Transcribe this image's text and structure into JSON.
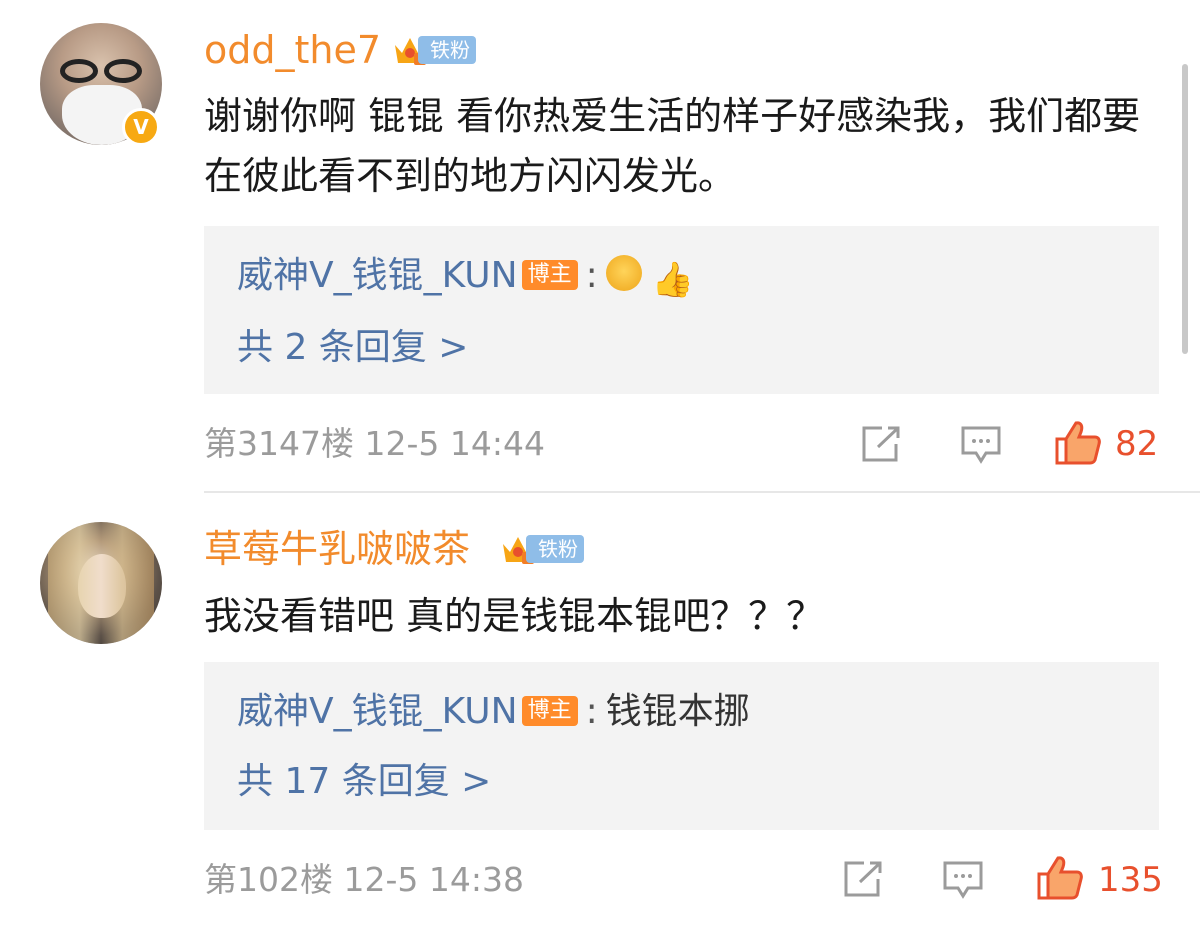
{
  "comments": [
    {
      "username": "odd_the7",
      "fan_badge": "铁粉",
      "text": "谢谢你啊 锟锟 看你热爱生活的样子好感染我，我们都要在彼此看不到的地方闪闪发光。",
      "reply": {
        "author": "威神V_钱锟_KUN",
        "badge": "博主",
        "colon": ":",
        "content": "",
        "emoji": [
          "smiling-face-emoji",
          "thumbs-up-emoji"
        ],
        "thumb_glyph": "👍",
        "count_text": "共 2 条回复 >"
      },
      "meta": "第3147楼 12-5 14:44",
      "likes": "82"
    },
    {
      "username": "草莓牛乳啵啵茶",
      "fan_badge": "铁粉",
      "text": "我没看错吧 真的是钱锟本锟吧？？？",
      "reply": {
        "author": "威神V_钱锟_KUN",
        "badge": "博主",
        "colon": ":",
        "content": "钱锟本挪",
        "count_text": "共 17 条回复 >"
      },
      "meta": "第102楼 12-5 14:38",
      "likes": "135"
    }
  ],
  "icons": {
    "verified": "V",
    "share": "share-icon",
    "comment": "comment-icon",
    "like": "thumbs-up-icon"
  },
  "colors": {
    "username": "#f28b2c",
    "reply_author": "#4f73a6",
    "like": "#e8502d",
    "fan_badge": "#8fbde8",
    "blogger_badge": "#ff8b2a"
  }
}
